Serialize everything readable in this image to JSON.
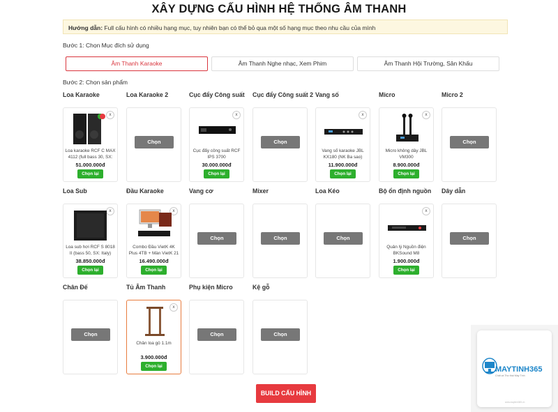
{
  "title": "XÂY DỰNG CẤU HÌNH HỆ THỐNG ÂM THANH",
  "guide": {
    "label": "Hướng dẫn:",
    "text": "Full cấu hình có nhiều hạng mục, tuy nhiên bạn có thể bỏ qua một số hạng mục theo nhu cầu của mình"
  },
  "step1": "Bước 1: Chọn Mục đích sử dụng",
  "purposes": [
    "Âm Thanh Karaoke",
    "Âm Thanh Nghe nhạc, Xem Phim",
    "Âm Thanh Hội Trường, Sân Khấu"
  ],
  "active_purpose": "Âm Thanh Karaoke",
  "step2": "Bước 2: Chọn sản phẩm",
  "choose_label": "Chọn",
  "rechoose_label": "Chọn lại",
  "remove_label": "x",
  "categories": [
    {
      "name": "Loa Karaoke",
      "product": {
        "name": "Loa karaoke RCF C MAX 4112 (full bass 30, SX:",
        "price": "51.000.000đ"
      }
    },
    {
      "name": "Loa Karaoke 2"
    },
    {
      "name": "Cục đẩy Công suất",
      "product": {
        "name": "Cục đẩy công suất RCF IPS 3700",
        "price": "30.000.000đ"
      }
    },
    {
      "name": "Cục đẩy Công suất 2"
    },
    {
      "name": "Vang số",
      "product": {
        "name": "Vang số karaoke JBL KX180 (NK Ba sao)",
        "price": "11.900.000đ"
      }
    },
    {
      "name": "Micro",
      "product": {
        "name": "Micro không dây JBL VM300",
        "price": "8.900.000đ"
      }
    },
    {
      "name": "Micro 2"
    },
    {
      "name": "Loa Sub",
      "product": {
        "name": "Loa sub hơi RCF S 8018 II (bass 50, SX: Italy)",
        "price": "38.850.000đ"
      }
    },
    {
      "name": "Đầu Karaoke",
      "product": {
        "name": "Combo Đầu VietK 4K Plus 4TB + Màn VietK 21",
        "price": "16.490.000đ"
      }
    },
    {
      "name": "Vang cơ"
    },
    {
      "name": "Mixer"
    },
    {
      "name": "Loa Kéo"
    },
    {
      "name": "Bộ ổn định nguồn",
      "product": {
        "name": "Quản lý Nguồn điện BKSound M8",
        "price": "1.900.000đ"
      }
    },
    {
      "name": "Dây dẫn"
    },
    {
      "name": "Chân Đế"
    },
    {
      "name": "Tủ Âm Thanh",
      "product": {
        "name": "Chân loa gỗ 1.1m",
        "price": "3.900.000đ"
      }
    },
    {
      "name": "Phụ kiện Micro"
    },
    {
      "name": "Kệ gỗ"
    }
  ],
  "build_button": "BUILD CẤU HÌNH",
  "logo": {
    "text": "MAYTINH365",
    "tagline": "Chất và Thư thái Máy Tính",
    "foot": "www.maytinh365.vn"
  },
  "colors": {
    "accent": "#e73a3f",
    "green": "#2daf2d",
    "choose_gray": "#777777",
    "logo_blue": "#1d86c9"
  }
}
